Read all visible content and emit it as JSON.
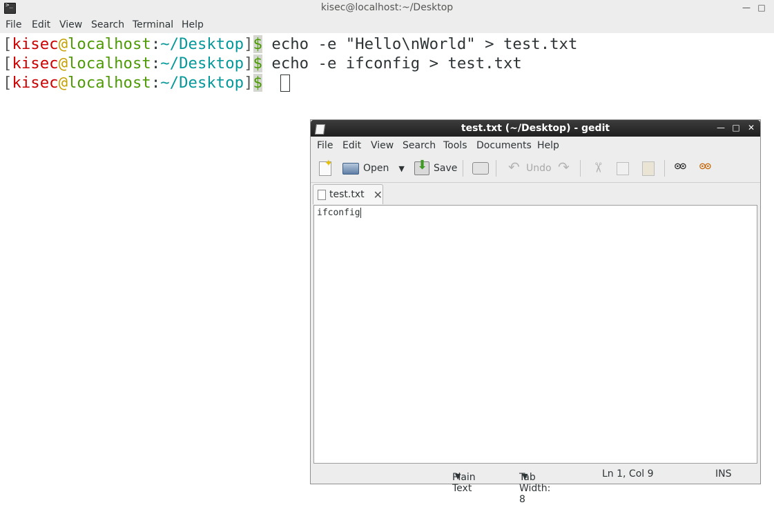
{
  "terminal": {
    "title": "kisec@localhost:~/Desktop",
    "menu": [
      "File",
      "Edit",
      "View",
      "Search",
      "Terminal",
      "Help"
    ],
    "prompt": {
      "open": "[",
      "user": "kisec",
      "at": "@",
      "host": "localhost",
      "colon": ":",
      "path": "~/Desktop",
      "close": "]",
      "symbol": "$"
    },
    "lines": [
      "echo -e \"Hello\\nWorld\" > test.txt",
      "echo -e ifconfig > test.txt"
    ]
  },
  "gedit": {
    "title": "test.txt (~/Desktop) - gedit",
    "menu": [
      "File",
      "Edit",
      "View",
      "Search",
      "Tools",
      "Documents",
      "Help"
    ],
    "toolbar": {
      "open_label": "Open",
      "save_label": "Save",
      "undo_label": "Undo"
    },
    "tab_label": "test.txt",
    "editor_content": "ifconfig",
    "status": {
      "language": "Plain Text",
      "tab_width": "Tab Width:  8",
      "position": "Ln 1, Col 9",
      "mode": "INS"
    }
  }
}
